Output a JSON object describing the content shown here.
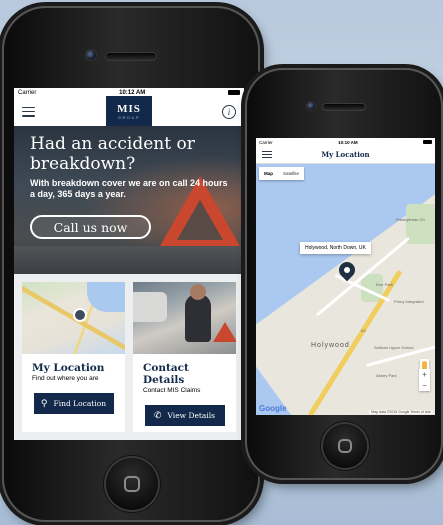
{
  "left_phone": {
    "status": {
      "carrier": "Carrier",
      "time": "10:12 AM"
    },
    "logo": {
      "line1": "MIS",
      "line2": "GROUP"
    },
    "hero": {
      "title": "Had an accident or breakdown?",
      "text": "With breakdown cover we are on call 24 hours a day, 365 days a year.",
      "call_label": "Call us now"
    },
    "cards": [
      {
        "title": "My Location",
        "subtitle": "Find out where you are",
        "button": "Find Location",
        "icon": "map-pin-icon"
      },
      {
        "title": "Contact Details",
        "subtitle": "Contact MIS Claims",
        "button": "View Details",
        "icon": "phone-icon"
      }
    ],
    "colors": {
      "brand": "#13294b",
      "hero_bg": "#3e4a55",
      "card_bg": "#eceeef"
    }
  },
  "right_phone": {
    "status": {
      "carrier": "Carrier",
      "time": "10:10 AM"
    },
    "title": "My Location",
    "map_types": [
      "Map",
      "Satellite"
    ],
    "active_map_type": "Map",
    "tooltip": "Holywood, North Down, UK",
    "labels": {
      "presbyterian": "Presbyterian Ch",
      "holywood": "Holywood",
      "sullivan": "Sullivan Upper School",
      "priory": "Priory Integrated",
      "kerr_park": "Kerr Park",
      "abbey_park": "Abbey Park",
      "road_a2": "A2"
    },
    "footer": "Map data ©2015 Google   Terms of Use",
    "google": "Google",
    "zoom": [
      "+",
      "−"
    ]
  }
}
